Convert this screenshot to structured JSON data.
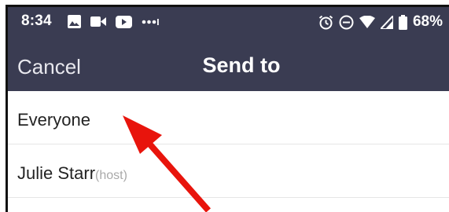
{
  "status_bar": {
    "time": "8:34",
    "battery_percent": "68%",
    "left_icons": [
      "image-icon",
      "video-camera-icon",
      "youtube-icon",
      "more-dots-icon"
    ],
    "right_icons": [
      "alarm-icon",
      "do-not-disturb-icon",
      "wifi-icon",
      "signal-icon",
      "battery-icon"
    ]
  },
  "nav": {
    "cancel_label": "Cancel",
    "title": "Send to"
  },
  "recipients": [
    {
      "name": "Everyone",
      "role": ""
    },
    {
      "name": "Julie Starr",
      "role": "(host)"
    }
  ],
  "colors": {
    "header_bg": "#3a3c52",
    "arrow": "#e8140c"
  }
}
